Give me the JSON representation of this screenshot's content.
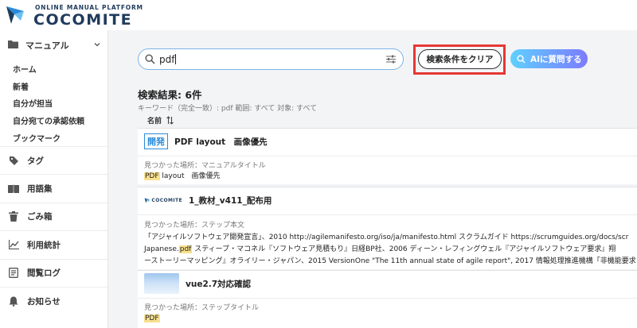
{
  "header": {
    "logo_sub": "ONLINE MANUAL PLATFORM",
    "logo_main": "COCOMITE"
  },
  "sidebar": {
    "manual_label": "マニュアル",
    "sub_items": [
      "ホーム",
      "新着",
      "自分が担当",
      "自分宛ての承認依頼",
      "ブックマーク"
    ],
    "items": [
      {
        "label": "タグ",
        "icon": "tag-icon"
      },
      {
        "label": "用語集",
        "icon": "book-icon"
      },
      {
        "label": "ごみ箱",
        "icon": "trash-icon"
      },
      {
        "label": "利用統計",
        "icon": "chart-icon"
      },
      {
        "label": "閲覧ログ",
        "icon": "log-icon"
      },
      {
        "label": "お知らせ",
        "icon": "bell-icon"
      }
    ]
  },
  "search": {
    "value": "pdf",
    "clear_label": "検索条件をクリア",
    "ai_label": "AIに質問する"
  },
  "results": {
    "title": "検索結果: 6件",
    "conditions": "キーワード（完全一致）: pdf  範囲: すべて  対象: すべて",
    "sort_label": "名前"
  },
  "cards": [
    {
      "badge": "開発",
      "title": "PDF layout　画像優先",
      "found": "見つかった場所：マニュアルタイトル",
      "snippet_hl": "PDF",
      "snippet_rest": " layout　画像優先"
    },
    {
      "thumb_text": "COCOMITE",
      "title": "1_教材_v411_配布用",
      "found": "見つかった場所：ステップ本文",
      "line1": "「アジャイルソフトウェア開発宣言」、2010 http://agilemanifesto.org/iso/ja/manifesto.html スクラムガイド https://scrumguides.org/docs/scr",
      "line2_pre": "Japanese.",
      "line2_hl": "pdf",
      "line2_post": " スティーブ・マコネル『ソフトウェア見積もり』日経BP社、2006 ディーン・レフィングウェル『アジャイルソフトウェア要求』翔",
      "line3": "ーストーリーマッピング』オライリー・ジャパン、2015 VersionOne \"The 11th annual state of agile report\", 2017 情報処理推進機構「非機能要求"
    },
    {
      "title": "vue2.7対応確認",
      "found": "見つかった場所：ステップタイトル",
      "snippet_hl": "PDF"
    }
  ]
}
